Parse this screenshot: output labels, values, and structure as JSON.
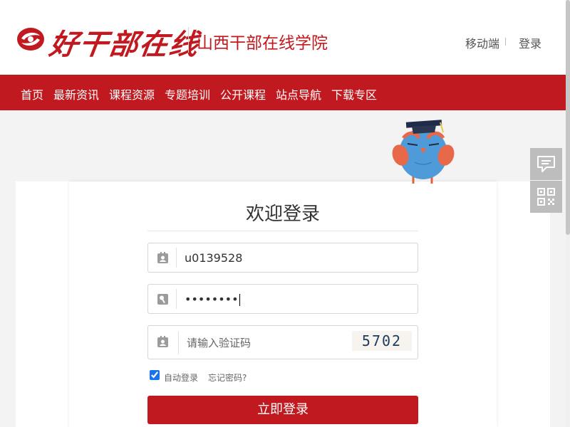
{
  "header": {
    "logo": "haoganbu-logo",
    "brand_script": "好干部在线",
    "site_title": "山西干部在线学院",
    "mobile_link": "移动端",
    "login_link": "登录"
  },
  "nav": {
    "items": [
      {
        "label": "首页"
      },
      {
        "label": "最新资讯"
      },
      {
        "label": "课程资源"
      },
      {
        "label": "专题培训"
      },
      {
        "label": "公开课程"
      },
      {
        "label": "站点导航"
      },
      {
        "label": "下载专区"
      }
    ]
  },
  "login": {
    "title": "欢迎登录",
    "username": "u0139528",
    "password_mask": "••••••••",
    "captcha_placeholder": "请输入验证码",
    "captcha_code": "5702",
    "remember_label": "自动登录",
    "remember_checked": true,
    "forgot_label": "忘记密码?",
    "submit_label": "立即登录"
  },
  "side_tools": [
    {
      "name": "feedback-icon"
    },
    {
      "name": "qrcode-icon"
    }
  ],
  "colors": {
    "brand_red": "#c0191f",
    "page_bg": "#f3f3f3",
    "side_tool_bg": "#bdbdbd",
    "owl_blue": "#4f9bd9"
  }
}
